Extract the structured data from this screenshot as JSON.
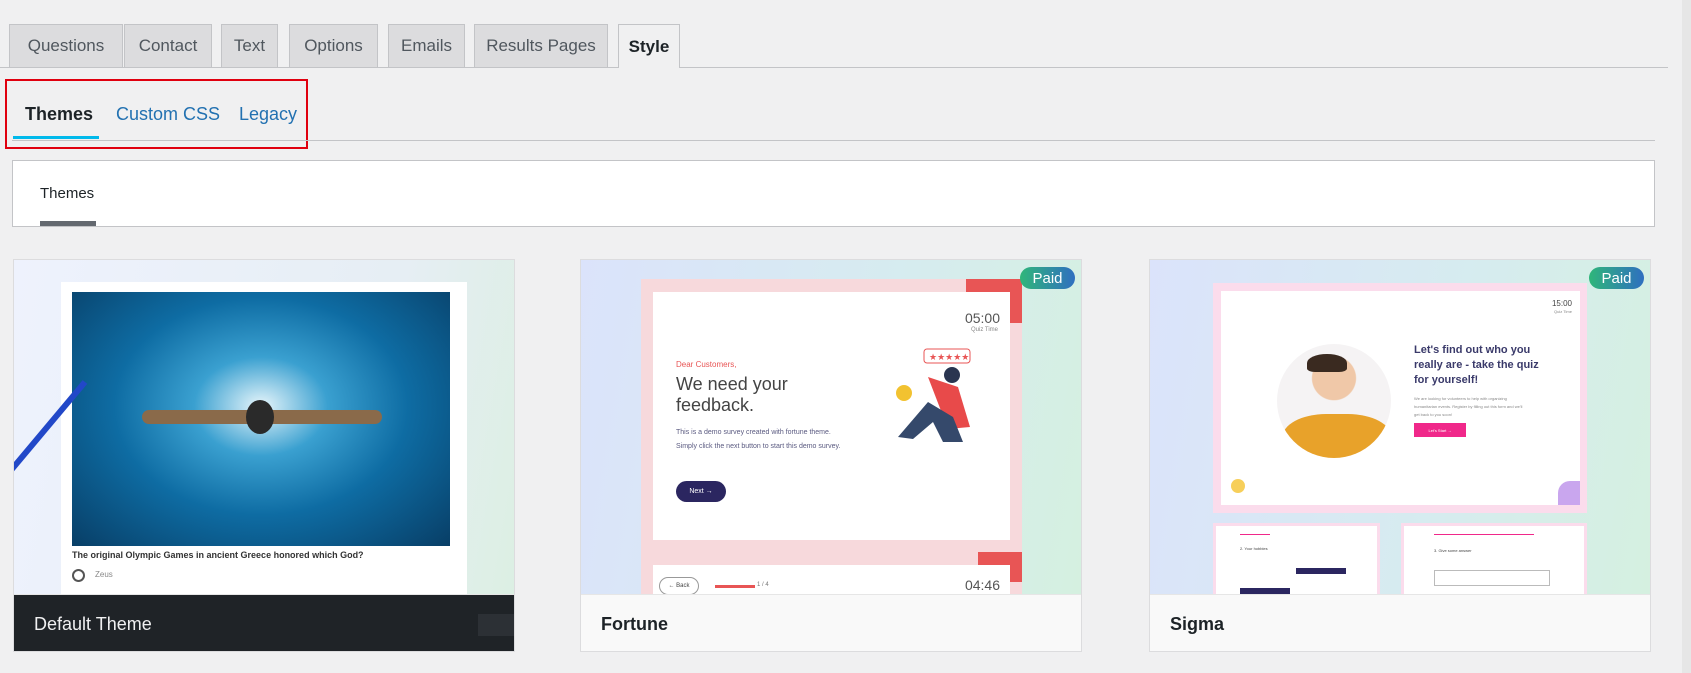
{
  "tabs": [
    {
      "label": "Questions"
    },
    {
      "label": "Contact"
    },
    {
      "label": "Text"
    },
    {
      "label": "Options"
    },
    {
      "label": "Emails"
    },
    {
      "label": "Results Pages"
    },
    {
      "label": "Style",
      "active": true
    }
  ],
  "subtabs": [
    {
      "label": "Themes",
      "active": true
    },
    {
      "label": "Custom CSS"
    },
    {
      "label": "Legacy"
    }
  ],
  "panel": {
    "label": "Themes"
  },
  "themes": [
    {
      "name": "Default Theme",
      "question": "The original Olympic Games in ancient Greece honored which God?",
      "option": "Zeus"
    },
    {
      "name": "Fortune",
      "badge": "Paid",
      "timer": "05:00",
      "timer_label": "Quiz Time",
      "greeting": "Dear Customers,",
      "heading": "We need your feedback.",
      "body": "This is a demo survey created with fortune theme. Simply click the next button to start this demo survey.",
      "next": "Next →",
      "back": "← Back",
      "progress": "1 / 4",
      "timer2": "04:46"
    },
    {
      "name": "Sigma",
      "badge": "Paid",
      "timer": "15:00",
      "timer_label": "Quiz Time",
      "heading": "Let's find out who you really are - take the quiz for yourself!",
      "body": "We are looking for volunteers to help with organizing humanitarian events. Register by filling out this form and we'll get back to you soon!",
      "cta": "Let's Start →",
      "q2": "2. Your hobbies",
      "q3": "3. Give some answer"
    }
  ],
  "colors": {
    "accent": "#00b9eb",
    "link": "#2271b1",
    "highlight": "#e0000f"
  }
}
